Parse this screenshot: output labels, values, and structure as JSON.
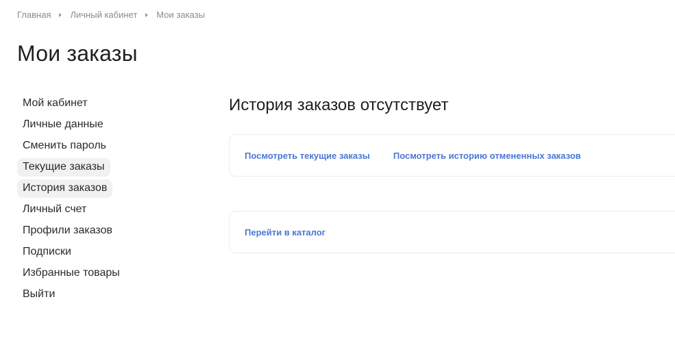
{
  "breadcrumb": {
    "items": [
      "Главная",
      "Личный кабинет",
      "Мои заказы"
    ]
  },
  "page": {
    "title": "Мои заказы"
  },
  "sidebar": {
    "items": [
      {
        "label": "Мой кабинет",
        "active": false
      },
      {
        "label": "Личные данные",
        "active": false
      },
      {
        "label": "Сменить пароль",
        "active": false
      },
      {
        "label": "Текущие заказы",
        "active": true
      },
      {
        "label": "История заказов",
        "active": true
      },
      {
        "label": "Личный счет",
        "active": false
      },
      {
        "label": "Профили заказов",
        "active": false
      },
      {
        "label": "Подписки",
        "active": false
      },
      {
        "label": "Избранные товары",
        "active": false
      },
      {
        "label": "Выйти",
        "active": false
      }
    ]
  },
  "main": {
    "heading": "История заказов отсутствует",
    "links_card": {
      "current_orders": "Посмотреть текущие заказы",
      "cancelled_history": "Посмотреть историю отмененных заказов"
    },
    "catalog_card": {
      "catalog_link": "Перейти в каталог"
    }
  },
  "colors": {
    "link": "#4b76d6",
    "active_bg": "#f1f1f1",
    "breadcrumb": "#8a8a8a"
  }
}
